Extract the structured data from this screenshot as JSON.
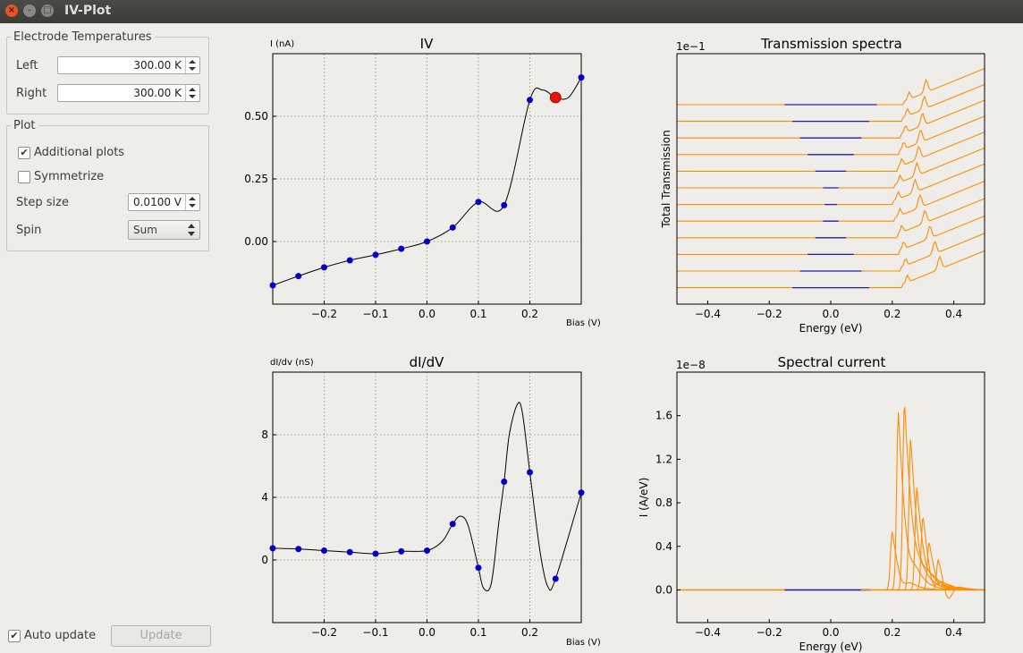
{
  "window": {
    "title": "IV-Plot",
    "close_glyph": "×",
    "min_glyph": "–",
    "max_glyph": "□"
  },
  "electrode": {
    "legend": "Electrode Temperatures",
    "left_label": "Left",
    "left_value": "300.00 K",
    "right_label": "Right",
    "right_value": "300.00 K"
  },
  "plot": {
    "legend": "Plot",
    "additional_label": "Additional plots",
    "additional_checked": true,
    "symmetrize_label": "Symmetrize",
    "symmetrize_checked": false,
    "step_label": "Step size",
    "step_value": "0.0100 V",
    "spin_label": "Spin",
    "spin_value": "Sum"
  },
  "footer": {
    "auto_update_label": "Auto update",
    "auto_update_checked": true,
    "update_button": "Update"
  },
  "colors": {
    "dots": "#0000c8",
    "selected": "#e8120c",
    "orange": "#ff8c00",
    "blue": "#2020b0"
  },
  "charts": {
    "iv": {
      "title": "IV",
      "ylabel": "I (nA)",
      "xlabel": "Bias (V)",
      "x_ticks": [
        "−0.2",
        "−0.1",
        "0.0",
        "0.1",
        "0.2"
      ],
      "y_ticks": [
        "0.50",
        "0.25",
        "0.00"
      ]
    },
    "didv": {
      "title": "dI/dV",
      "ylabel": "dI/dv (nS)",
      "xlabel": "Bias (V)",
      "x_ticks": [
        "−0.2",
        "−0.1",
        "0.0",
        "0.1",
        "0.2"
      ],
      "y_ticks": [
        "8",
        "4",
        "0"
      ]
    },
    "trans": {
      "title": "Transmission spectra",
      "ylabel": "Total Transmission",
      "xlabel": "Energy (eV)",
      "scale": "1e−1",
      "x_ticks": [
        "−0.4",
        "−0.2",
        "0.0",
        "0.2",
        "0.4"
      ]
    },
    "spec": {
      "title": "Spectral current",
      "ylabel": "I (A/eV)",
      "xlabel": "Energy (eV)",
      "scale": "1e−8",
      "x_ticks": [
        "−0.4",
        "−0.2",
        "0.0",
        "0.2",
        "0.4"
      ],
      "y_ticks": [
        "1.6",
        "1.2",
        "0.8",
        "0.4",
        "0.0"
      ]
    }
  },
  "chart_data": [
    {
      "type": "line",
      "title": "IV",
      "xlabel": "Bias (V)",
      "ylabel": "I (nA)",
      "xlim": [
        -0.3,
        0.3
      ],
      "ylim": [
        -0.25,
        0.75
      ],
      "grid": true,
      "x": [
        -0.3,
        -0.25,
        -0.2,
        -0.15,
        -0.1,
        -0.05,
        0.0,
        0.05,
        0.1,
        0.15,
        0.2,
        0.3
      ],
      "y": [
        -0.175,
        -0.138,
        -0.103,
        -0.075,
        -0.053,
        -0.029,
        0.0,
        0.056,
        0.158,
        0.145,
        0.565,
        0.655
      ],
      "selected_point": {
        "x": 0.25,
        "y": 0.575
      }
    },
    {
      "type": "line",
      "title": "dI/dV",
      "xlabel": "Bias (V)",
      "ylabel": "dI/dv (nS)",
      "xlim": [
        -0.3,
        0.3
      ],
      "ylim": [
        -4,
        12
      ],
      "grid": true,
      "x": [
        -0.3,
        -0.25,
        -0.2,
        -0.15,
        -0.1,
        -0.05,
        0.0,
        0.05,
        0.1,
        0.15,
        0.2,
        0.25,
        0.3
      ],
      "y": [
        0.75,
        0.7,
        0.6,
        0.5,
        0.4,
        0.55,
        0.6,
        2.3,
        -0.5,
        5.0,
        5.6,
        -1.2,
        4.3
      ]
    },
    {
      "type": "line",
      "title": "Transmission spectra",
      "xlabel": "Energy (eV)",
      "ylabel": "Total Transmission",
      "xlim": [
        -0.5,
        0.5
      ],
      "curves": 12
    },
    {
      "type": "line",
      "title": "Spectral current",
      "xlabel": "Energy (eV)",
      "ylabel": "I (A/eV)",
      "xlim": [
        -0.5,
        0.5
      ],
      "ylim": [
        -0.3,
        2.0
      ],
      "peaks": [
        0.2,
        0.22,
        0.24,
        0.26,
        0.28,
        0.3,
        0.32,
        0.35
      ],
      "peak_heights": [
        0.55,
        1.65,
        1.75,
        1.42,
        0.95,
        0.7,
        0.45,
        0.3
      ]
    }
  ]
}
